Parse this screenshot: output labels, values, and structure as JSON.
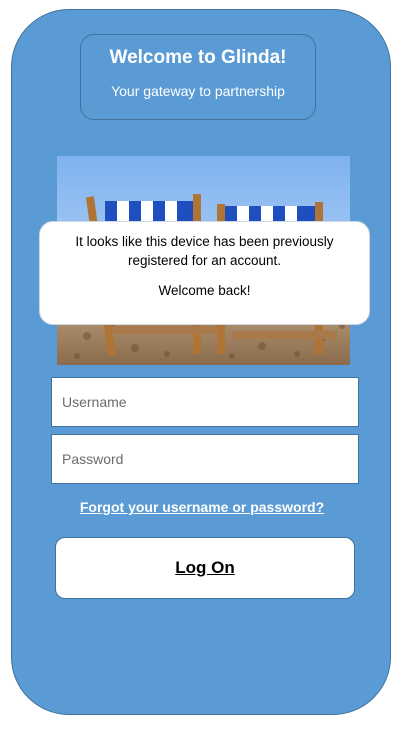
{
  "header": {
    "title": "Welcome to Glinda!",
    "subtitle": "Your gateway to partnership"
  },
  "image": {
    "icon": "beach-deckchairs-photo"
  },
  "popup": {
    "message": "It looks like this device has been previously registered for an account.",
    "welcome": "Welcome back!"
  },
  "form": {
    "username_placeholder": "Username",
    "password_placeholder": "Password",
    "forgot_label": "Forgot your username or password?",
    "logon_label": "Log On"
  },
  "colors": {
    "background": "#5b9bd5",
    "border": "#41719c"
  }
}
